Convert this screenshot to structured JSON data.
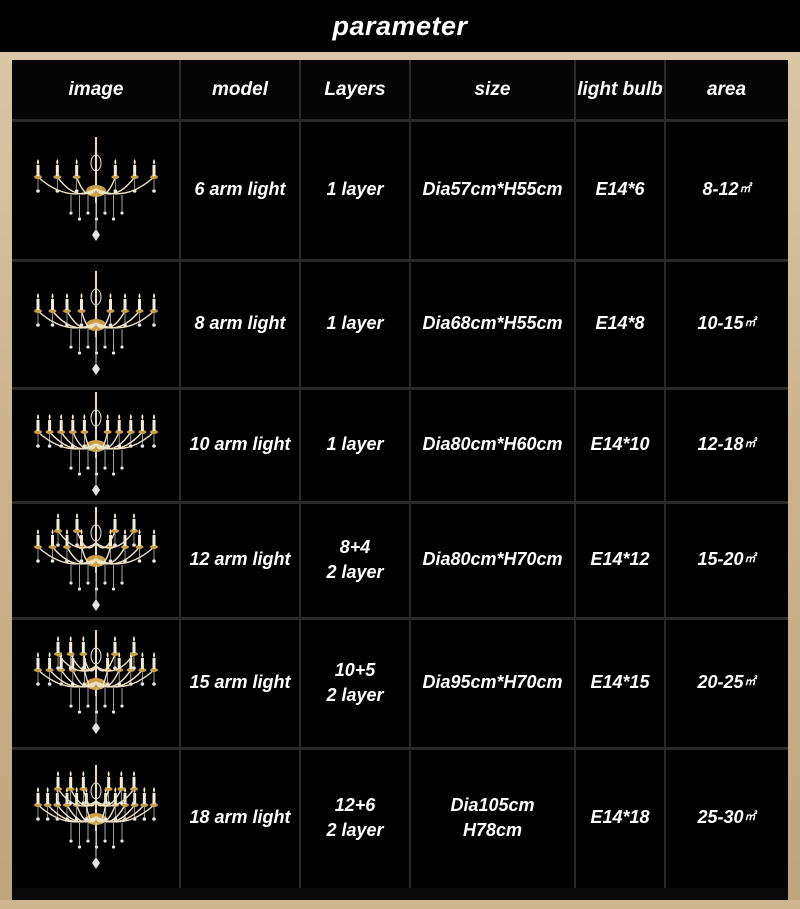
{
  "page": {
    "title": "parameter"
  },
  "colors": {
    "background": "#000000",
    "frame": "#cdb690",
    "text": "#ffffff",
    "crystal_gold": "#c9a048"
  },
  "table": {
    "headers": {
      "image": "image",
      "model": "model",
      "layers": "Layers",
      "size": "size",
      "bulb": "light bulb",
      "area": "area"
    },
    "unit_symbol": "㎡",
    "rows": [
      {
        "image_icon": "chandelier-icon",
        "model": "6 arm light",
        "layers": "1 layer",
        "size": "Dia57cm*H55cm",
        "bulb": "E14*6",
        "area": "8-12"
      },
      {
        "image_icon": "chandelier-icon",
        "model": "8 arm light",
        "layers": "1 layer",
        "size": "Dia68cm*H55cm",
        "bulb": "E14*8",
        "area": "10-15"
      },
      {
        "image_icon": "chandelier-icon",
        "model": "10 arm light",
        "layers": "1 layer",
        "size": "Dia80cm*H60cm",
        "bulb": "E14*10",
        "area": "12-18"
      },
      {
        "image_icon": "chandelier-icon",
        "model": "12 arm light",
        "layers": "8+4\n2 layer",
        "size": "Dia80cm*H70cm",
        "bulb": "E14*12",
        "area": "15-20"
      },
      {
        "image_icon": "chandelier-icon",
        "model": "15 arm light",
        "layers": "10+5\n2 layer",
        "size": "Dia95cm*H70cm",
        "bulb": "E14*15",
        "area": "20-25"
      },
      {
        "image_icon": "chandelier-icon",
        "model": "18 arm light",
        "layers": "12+6\n2 layer",
        "size": "Dia105cm\nH78cm",
        "bulb": "E14*18",
        "area": "25-30"
      }
    ]
  }
}
